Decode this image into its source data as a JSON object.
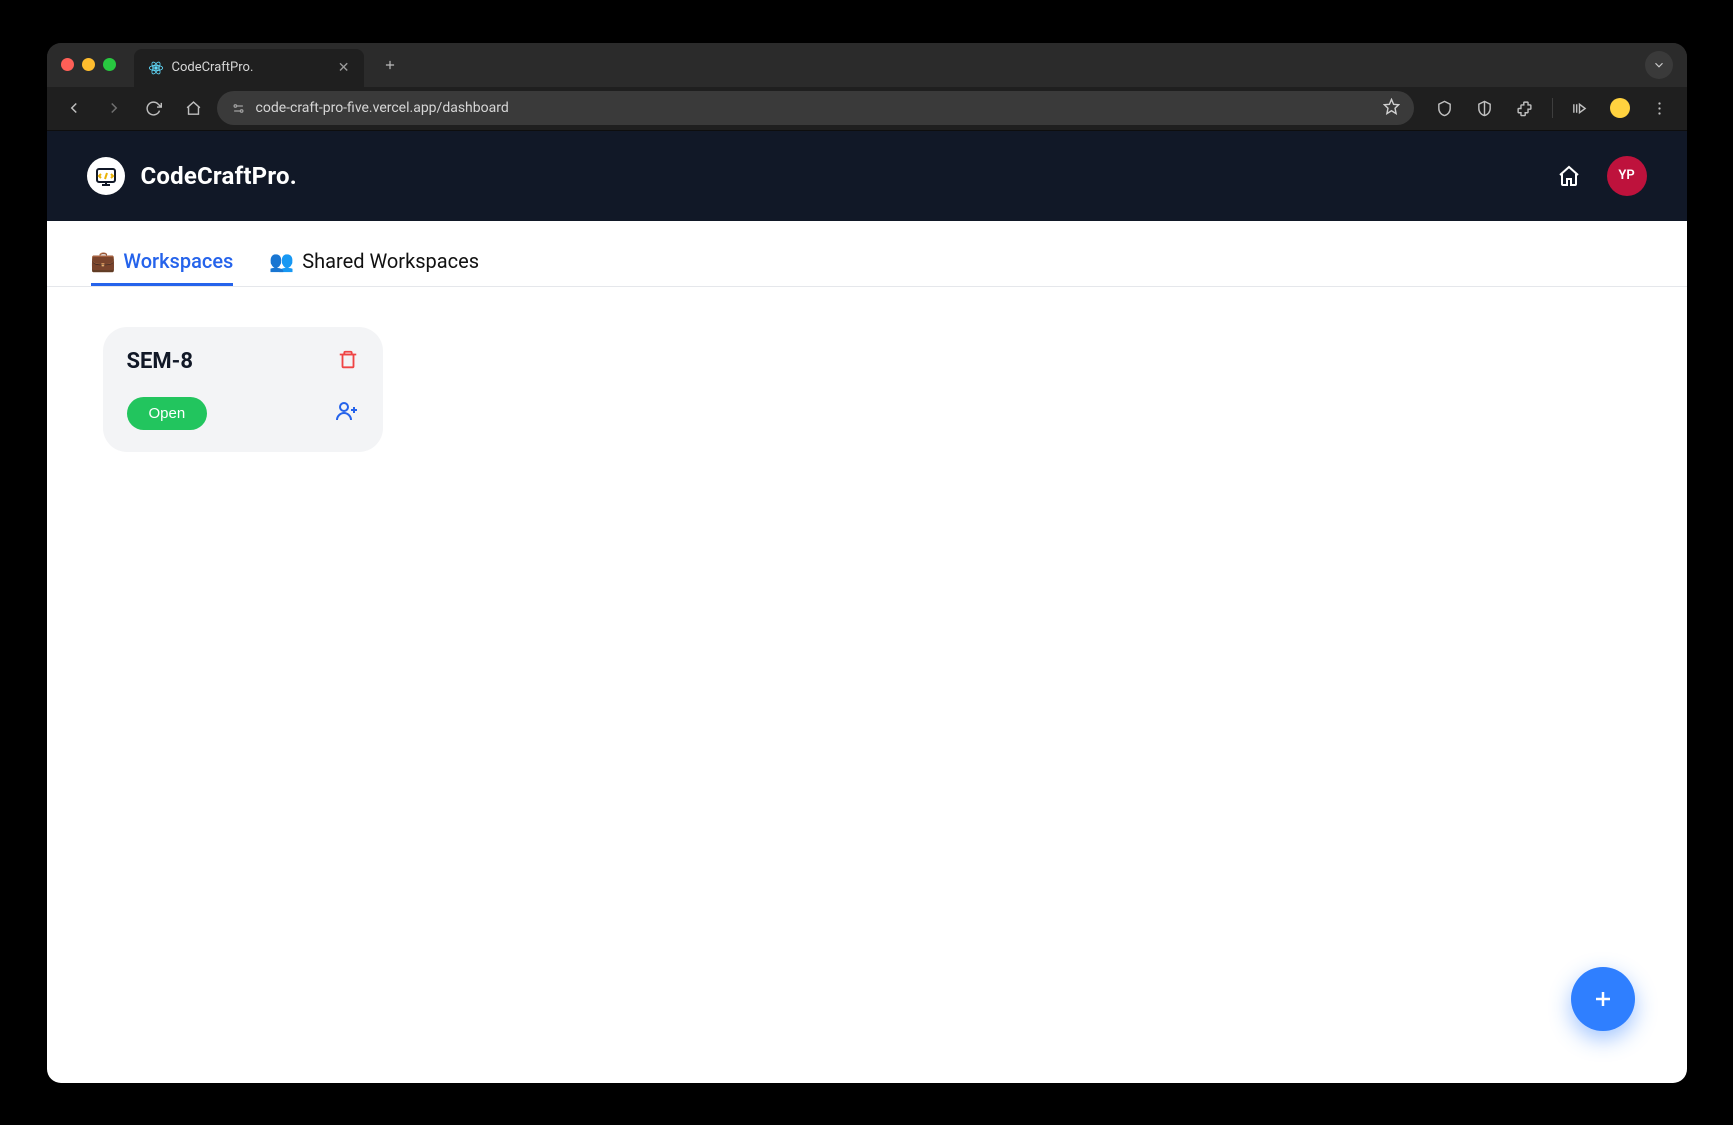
{
  "browser": {
    "tab_title": "CodeCraftPro.",
    "url": "code-craft-pro-five.vercel.app/dashboard"
  },
  "header": {
    "brand": "CodeCraftPro.",
    "avatar_initials": "YP"
  },
  "tabs": {
    "workspaces_emoji": "💼",
    "workspaces_label": "Workspaces",
    "shared_emoji": "👥",
    "shared_label": "Shared Workspaces"
  },
  "workspaces": [
    {
      "title": "SEM-8",
      "open_label": "Open"
    }
  ]
}
